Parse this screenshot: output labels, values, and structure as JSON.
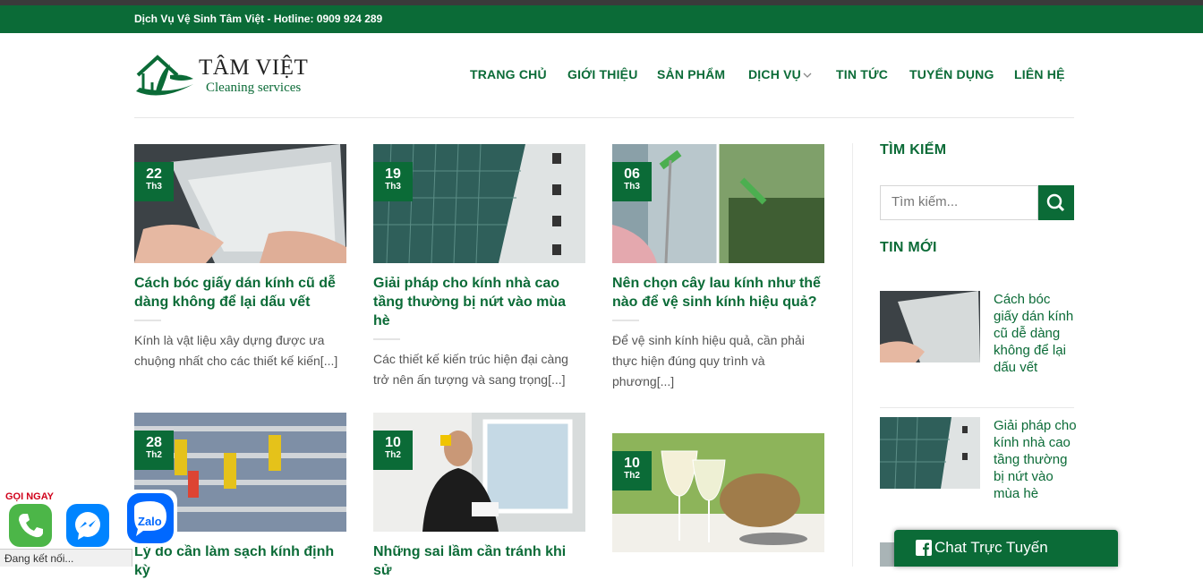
{
  "topbar": {
    "text": "Dịch Vụ Vệ Sinh Tâm Việt - Hotline: 0909 924 289"
  },
  "logo": {
    "name": "TÂM VIỆT",
    "sub": "Cleaning services"
  },
  "nav": [
    "TRANG CHỦ",
    "GIỚI THIỆU",
    "SẢN PHẨM",
    "DỊCH VỤ",
    "TIN TỨC",
    "TUYỂN DỤNG",
    "LIÊN HỆ"
  ],
  "posts": [
    {
      "day": "22",
      "month": "Th3",
      "title": "Cách bóc giấy dán kính cũ dễ dàng không để lại dấu vết",
      "excerpt": "Kính là vật liệu xây dựng được ưa chuộng nhất cho các thiết kế kiến[...]"
    },
    {
      "day": "19",
      "month": "Th3",
      "title": "Giải pháp cho kính nhà cao tầng thường bị nứt vào mùa hè",
      "excerpt": "Các thiết kế kiến trúc hiện đại càng trở nên ấn tượng và sang trọng[...]"
    },
    {
      "day": "06",
      "month": "Th3",
      "title": "Nên chọn cây lau kính như thế nào để vệ sinh kính hiệu quả?",
      "excerpt": "Để vệ sinh kính hiệu quả, cần phải thực hiện đúng quy trình và phương[...]"
    },
    {
      "day": "28",
      "month": "Th2",
      "title": "Lý do cần làm sạch kính định kỳ",
      "excerpt": ""
    },
    {
      "day": "10",
      "month": "Th2",
      "title": "Những sai lầm cần tránh khi sử",
      "excerpt": ""
    },
    {
      "day": "10",
      "month": "Th2",
      "title": "",
      "excerpt": ""
    }
  ],
  "sidebar": {
    "search_title": "TÌM KIẾM",
    "search_placeholder": "Tìm kiếm...",
    "recent_title": "TIN MỚI",
    "recent": [
      {
        "title": "Cách bóc giấy dán kính cũ dễ dàng không để lại dấu vết"
      },
      {
        "title": "Giải pháp cho kính nhà cao tầng thường bị nứt vào mùa hè"
      }
    ]
  },
  "widgets": {
    "call_label": "GỌI NGAY",
    "zalo_label": "Zalo",
    "status": "Đang kết nối...",
    "chat_label": "Chat Trực Tuyến"
  },
  "colors": {
    "brand": "#0b6b37",
    "call": "#d0021b",
    "messenger": "#0084ff",
    "zalo": "#0068ff"
  },
  "icons": [
    "house-leaf-logo-icon",
    "chevron-down-icon",
    "search-icon",
    "phone-icon",
    "messenger-icon",
    "zalo-icon",
    "facebook-icon"
  ]
}
